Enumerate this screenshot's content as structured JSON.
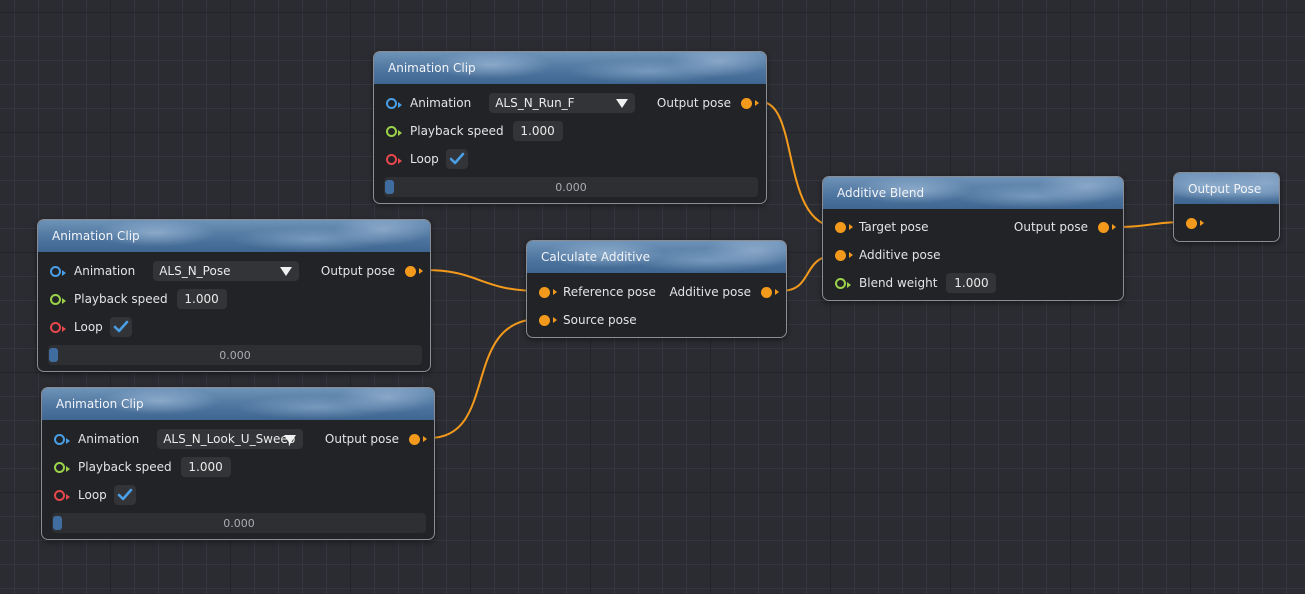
{
  "nodes": {
    "clip_run": {
      "title": "Animation Clip",
      "animation_label": "Animation",
      "animation_value": "ALS_N_Run_F",
      "speed_label": "Playback speed",
      "speed_value": "1.000",
      "loop_label": "Loop",
      "loop_checked": true,
      "output_label": "Output pose",
      "time_value": "0.000"
    },
    "clip_pose": {
      "title": "Animation Clip",
      "animation_label": "Animation",
      "animation_value": "ALS_N_Pose",
      "speed_label": "Playback speed",
      "speed_value": "1.000",
      "loop_label": "Loop",
      "loop_checked": true,
      "output_label": "Output pose",
      "time_value": "0.000"
    },
    "clip_look": {
      "title": "Animation Clip",
      "animation_label": "Animation",
      "animation_value": "ALS_N_Look_U_Sweep",
      "speed_label": "Playback speed",
      "speed_value": "1.000",
      "loop_label": "Loop",
      "loop_checked": true,
      "output_label": "Output pose",
      "time_value": "0.000"
    },
    "calc_additive": {
      "title": "Calculate Additive",
      "reference_label": "Reference pose",
      "source_label": "Source pose",
      "output_label": "Additive pose"
    },
    "additive_blend": {
      "title": "Additive Blend",
      "target_label": "Target pose",
      "additive_label": "Additive pose",
      "weight_label": "Blend weight",
      "weight_value": "1.000",
      "output_label": "Output pose"
    },
    "output_pose": {
      "title": "Output Pose"
    }
  },
  "colors": {
    "pose_pin": "#f39a1c",
    "animation_pin": "#4a9ee6",
    "float_pin": "#9bd24a",
    "bool_pin": "#e5474c",
    "wire": "#f39a1c",
    "header": "#4f76a0"
  },
  "icons": {
    "checkmark": "check-icon",
    "dropdown": "triangle-down-icon"
  }
}
